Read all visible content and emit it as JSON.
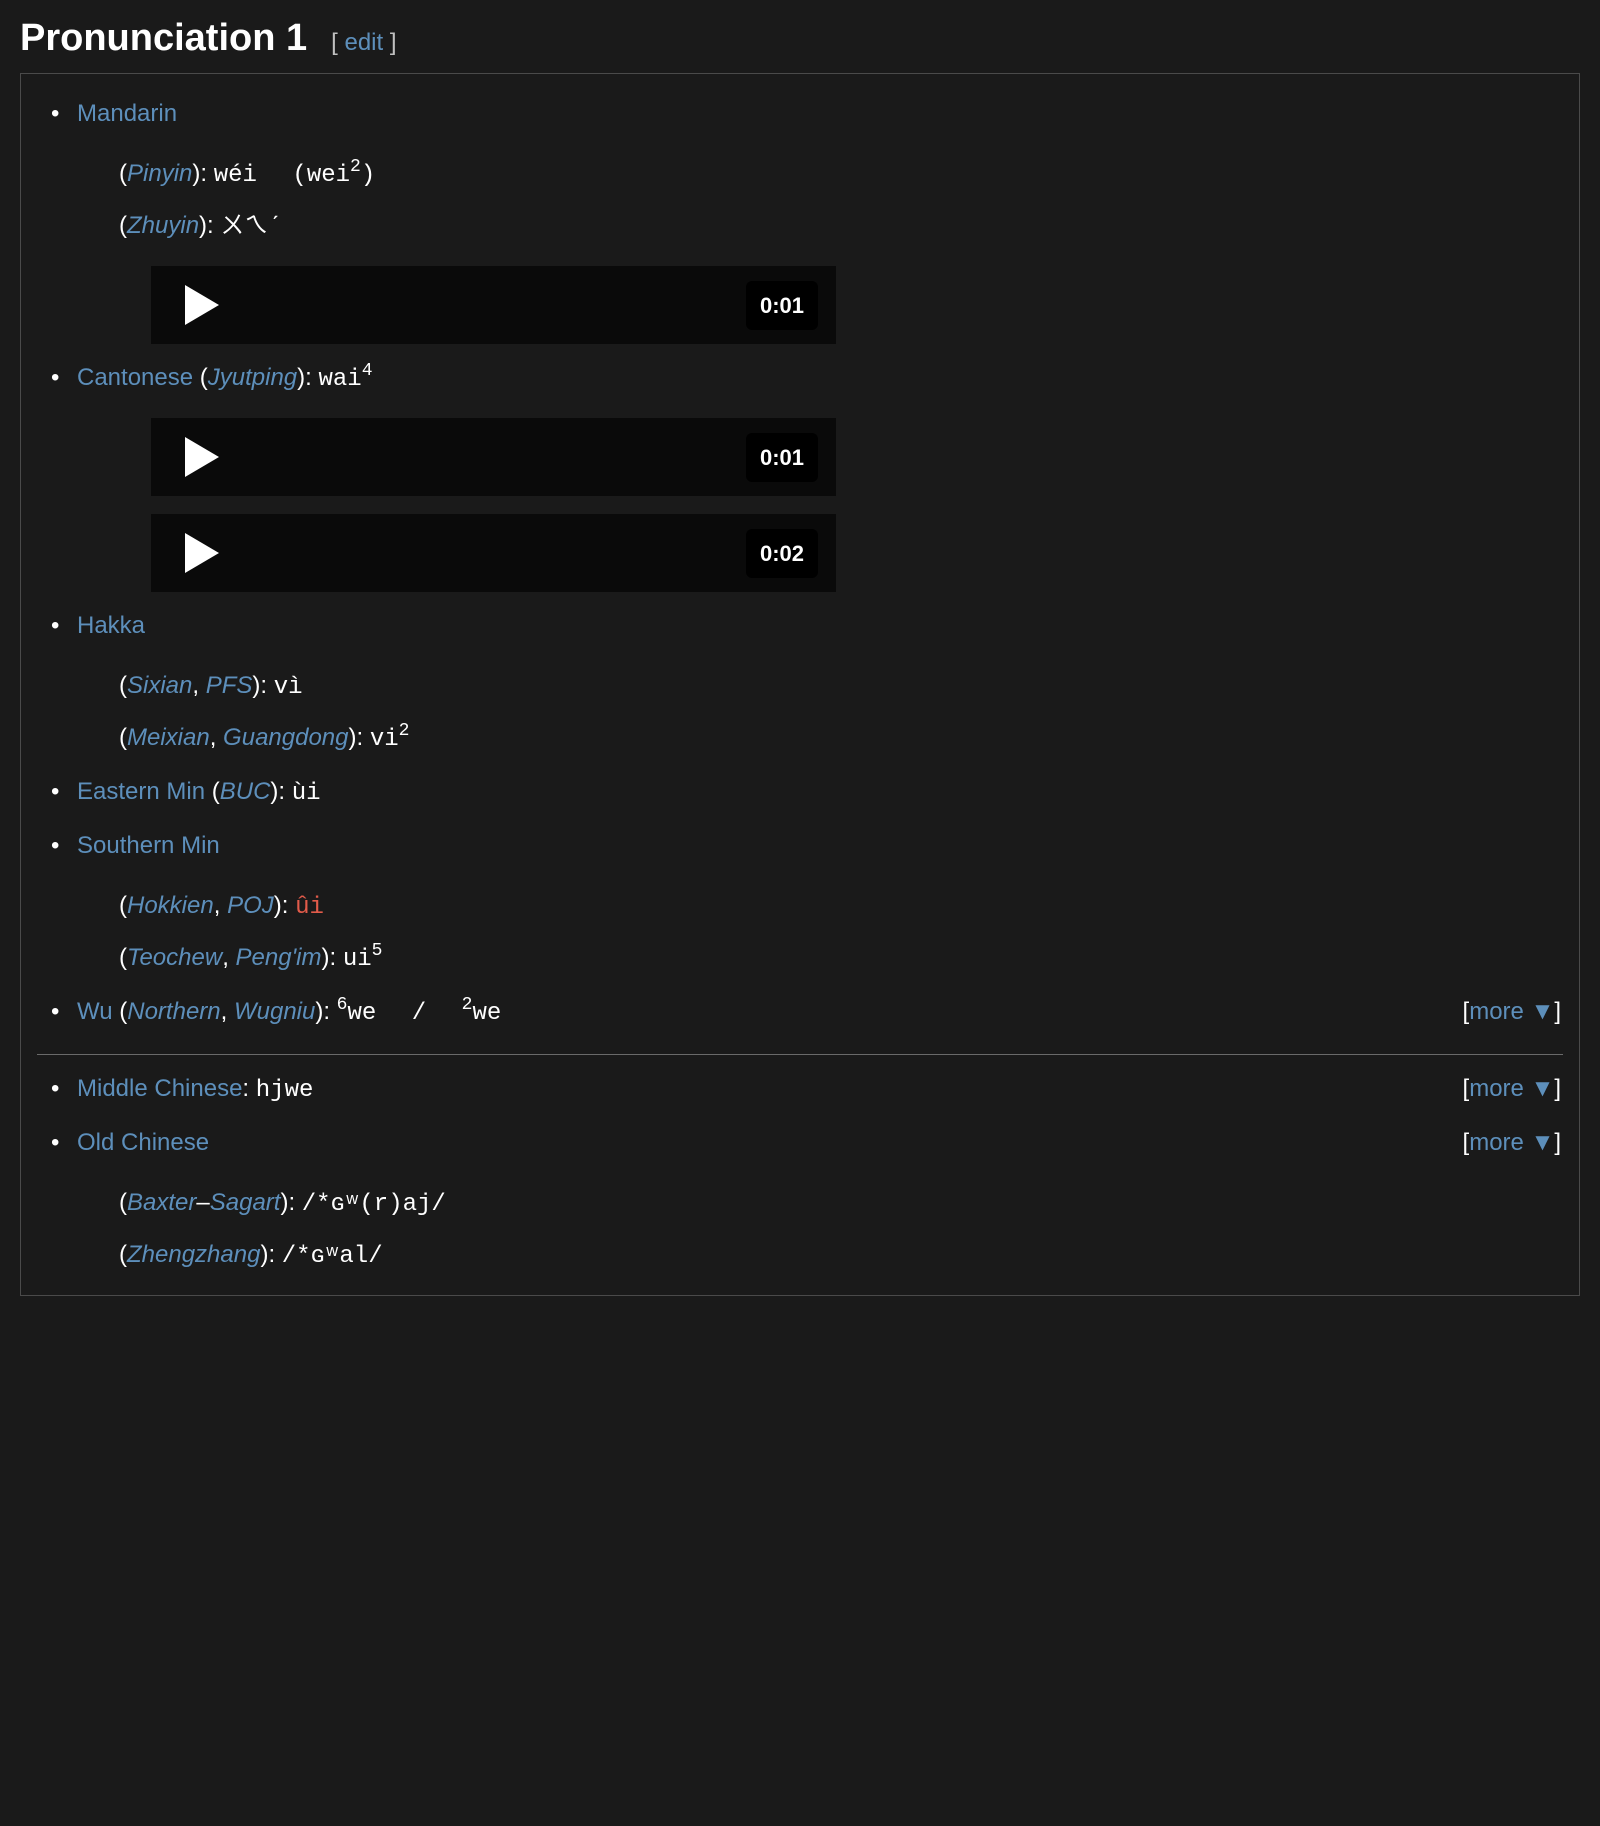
{
  "section": {
    "title": "Pronunciation 1",
    "edit": "edit"
  },
  "more_label": "more",
  "mandarin": {
    "name": "Mandarin",
    "pinyin_label": "Pinyin",
    "pinyin_value": "wéi",
    "pinyin_ascii_base": "wei",
    "pinyin_ascii_sup": "2",
    "zhuyin_label": "Zhuyin",
    "zhuyin_value": "ㄨㄟˊ",
    "audio_time": "0:01"
  },
  "cantonese": {
    "name": "Cantonese",
    "system": "Jyutping",
    "value_base": "wai",
    "value_sup": "4",
    "audio1_time": "0:01",
    "audio2_time": "0:02"
  },
  "hakka": {
    "name": "Hakka",
    "sixian_label": "Sixian",
    "pfs_label": "PFS",
    "sixian_value": "vì",
    "meixian_label": "Meixian",
    "guangdong_label": "Guangdong",
    "meixian_value_base": "vi",
    "meixian_value_sup": "2"
  },
  "eastern_min": {
    "name": "Eastern Min",
    "system": "BUC",
    "value": "ùi"
  },
  "southern_min": {
    "name": "Southern Min",
    "hokkien_label": "Hokkien",
    "poj_label": "POJ",
    "hokkien_value": "ûi",
    "teochew_label": "Teochew",
    "pengim_label": "Peng'im",
    "teochew_value_base": "ui",
    "teochew_value_sup": "5"
  },
  "wu": {
    "name": "Wu",
    "northern_label": "Northern",
    "wugniu_label": "Wugniu",
    "value1_sup": "6",
    "value1_base": "we",
    "value2_sup": "2",
    "value2_base": "we"
  },
  "middle_chinese": {
    "name": "Middle Chinese",
    "value": "hjwe"
  },
  "old_chinese": {
    "name": "Old Chinese",
    "bs_a": "Baxter",
    "bs_b": "Sagart",
    "bs_value": "/*ɢʷ(r)aj/",
    "zz_label": "Zhengzhang",
    "zz_value": "/*ɢʷal/"
  }
}
